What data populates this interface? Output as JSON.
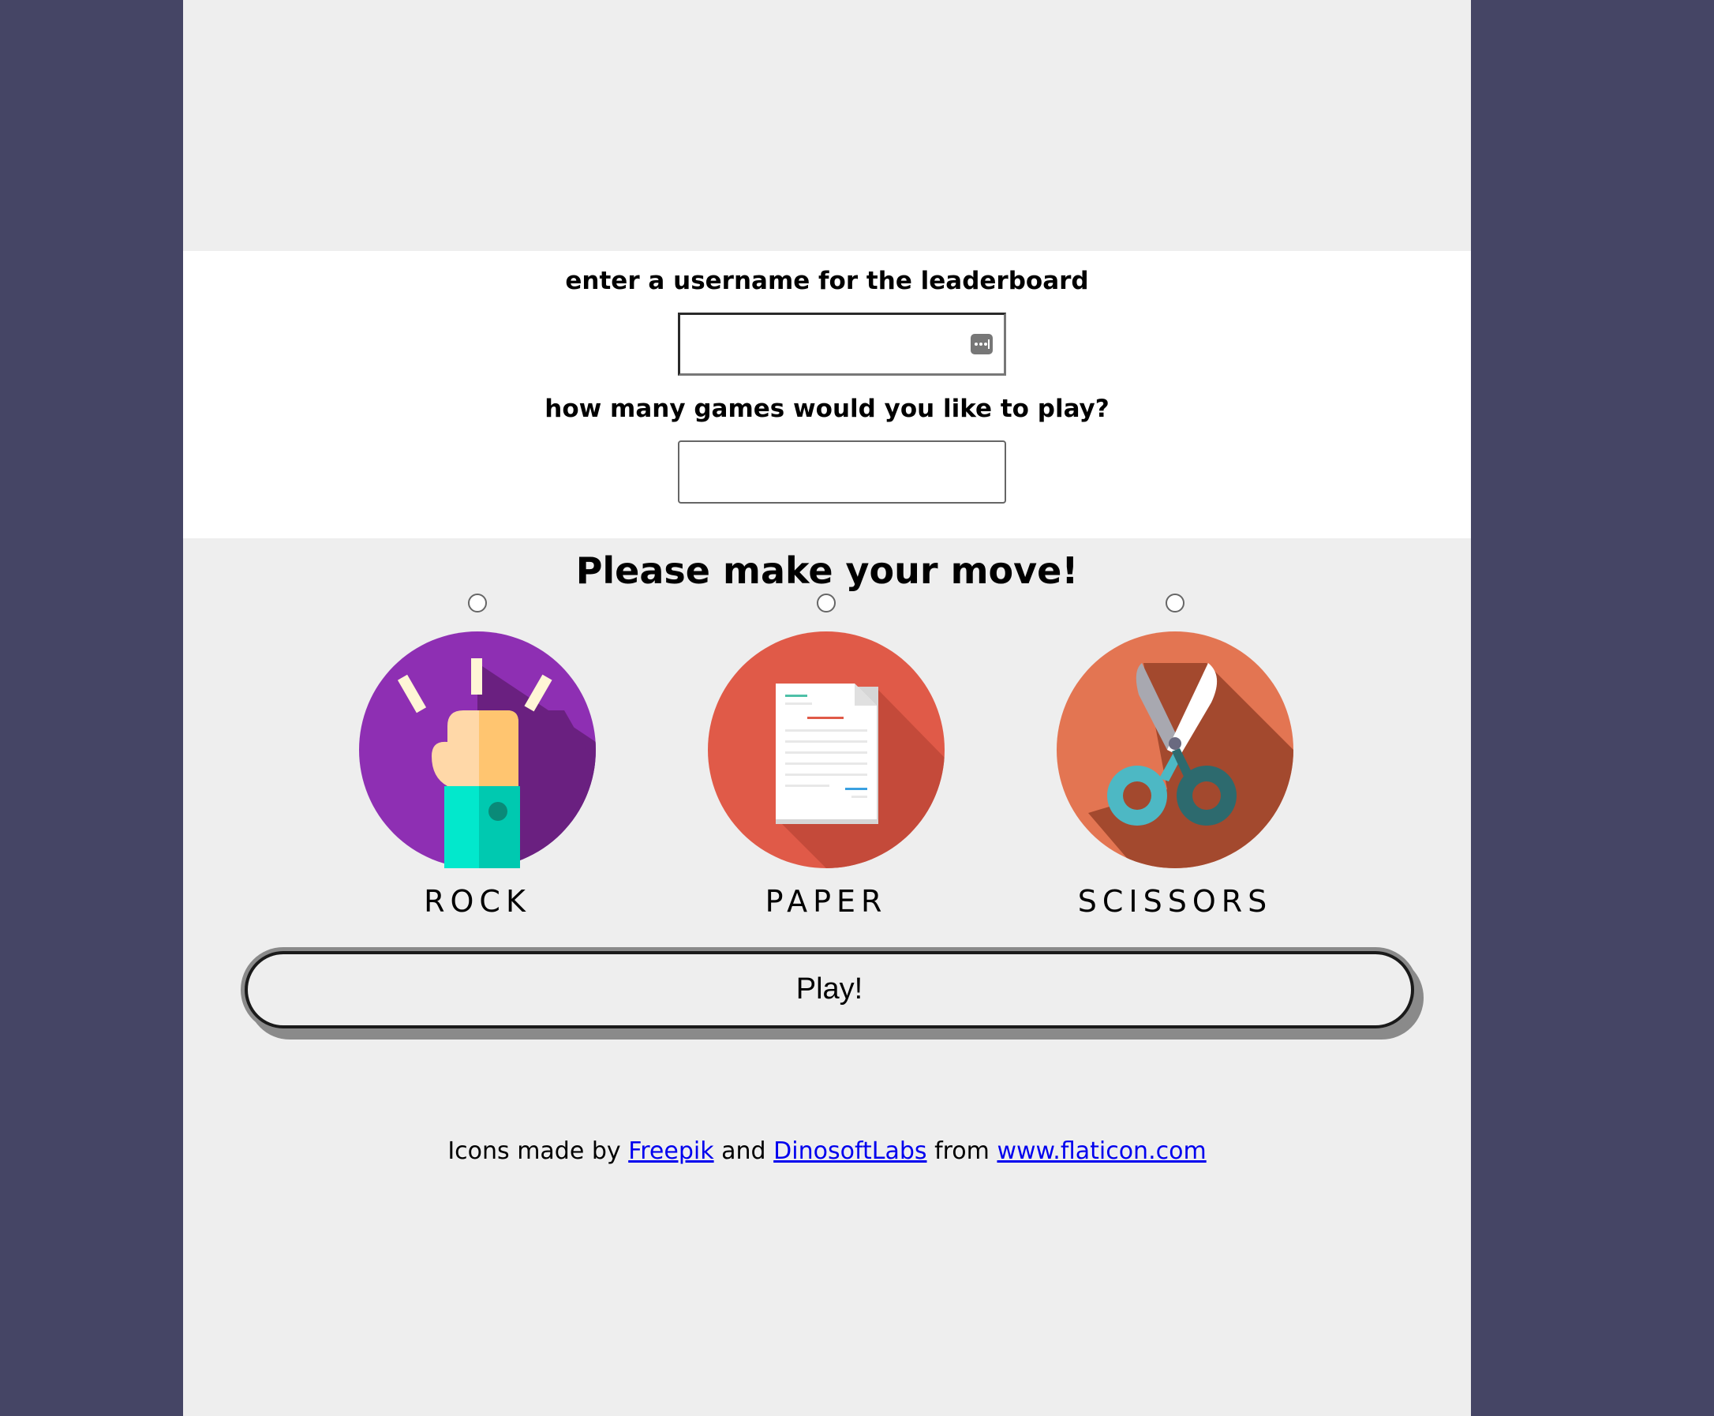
{
  "form": {
    "username_label": "enter a username for the leaderboard",
    "username_value": "",
    "games_label": "how many games would you like to play?",
    "games_value": ""
  },
  "move": {
    "heading": "Please make your move!",
    "choices": [
      {
        "label": "ROCK",
        "icon": "rock-fist-icon",
        "selected": false
      },
      {
        "label": "PAPER",
        "icon": "paper-document-icon",
        "selected": false
      },
      {
        "label": "SCISSORS",
        "icon": "scissors-icon",
        "selected": false
      }
    ],
    "play_label": "Play!"
  },
  "credits": {
    "prefix": "Icons made by",
    "author1": "Freepik",
    "and": "and",
    "author2": "DinosoftLabs",
    "from": "from",
    "site": "www.flaticon.com"
  },
  "colors": {
    "background": "#454565",
    "page": "#eeeeee",
    "form_band": "#ffffff",
    "rock_circle": "#8e2fb3",
    "paper_circle": "#e05a48",
    "scissors_circle": "#e37552",
    "link": "#0000ee"
  }
}
